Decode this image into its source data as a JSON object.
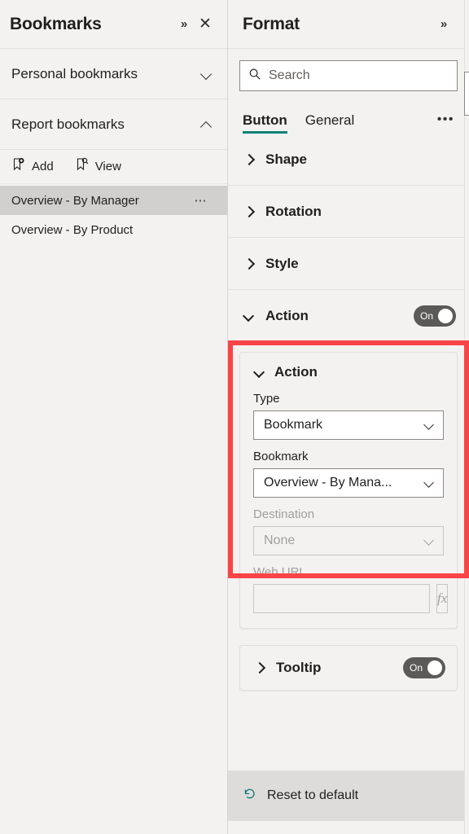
{
  "bookmarks_pane": {
    "title": "Bookmarks",
    "expand_icon": "chevron-double-right-icon",
    "close_icon": "close-icon",
    "sections": [
      {
        "label": "Personal bookmarks",
        "expanded": false
      },
      {
        "label": "Report bookmarks",
        "expanded": true
      }
    ],
    "toolbar": [
      {
        "label": "Add",
        "icon": "bookmark-add-icon"
      },
      {
        "label": "View",
        "icon": "bookmark-view-icon"
      }
    ],
    "items": [
      {
        "label": "Overview - By Manager",
        "selected": true,
        "more_icon": "ellipsis-horizontal-icon"
      },
      {
        "label": "Overview - By Product",
        "selected": false
      }
    ]
  },
  "format_pane": {
    "title": "Format",
    "expand_icon": "chevron-double-right-icon",
    "search": {
      "placeholder": "Search",
      "value": "",
      "icon": "search-icon"
    },
    "tabs": [
      {
        "label": "Button",
        "active": true
      },
      {
        "label": "General",
        "active": false
      }
    ],
    "tabs_more": "•••",
    "sections": [
      {
        "label": "Shape",
        "expanded": false
      },
      {
        "label": "Rotation",
        "expanded": false
      },
      {
        "label": "Style",
        "expanded": false
      }
    ],
    "action_section": {
      "label": "Action",
      "expanded": true,
      "toggle": {
        "state": "On",
        "enabled": true
      },
      "sub_section": {
        "label": "Action",
        "expanded": true,
        "fields": [
          {
            "label": "Type",
            "value": "Bookmark",
            "disabled": false,
            "chevron_icon": "chevron-down-icon"
          },
          {
            "label": "Bookmark",
            "value": "Overview - By Mana...",
            "disabled": false,
            "chevron_icon": "chevron-down-icon"
          },
          {
            "label": "Destination",
            "value": "None",
            "disabled": true,
            "chevron_icon": "chevron-down-icon"
          }
        ],
        "web_url": {
          "label": "Web URL",
          "value": "",
          "disabled": true,
          "fx_label": "fx",
          "fx_icon": "function-icon"
        }
      }
    },
    "tooltip_section": {
      "label": "Tooltip",
      "expanded": false,
      "toggle": {
        "state": "On",
        "enabled": true
      }
    },
    "reset": {
      "label": "Reset to default",
      "icon": "undo-icon"
    }
  },
  "highlight": {
    "color": "#fa4446",
    "target": "action-section"
  },
  "theme": {
    "panel_bg": "#f3f2f1",
    "selected_row_bg": "#d2d0ce",
    "accent_tab_underline": "#118272",
    "toggle_on_bg": "#5c5a58",
    "reset_bar_bg": "#dedcdb",
    "text_primary": "#201f1e",
    "text_disabled": "#a19f9d"
  }
}
